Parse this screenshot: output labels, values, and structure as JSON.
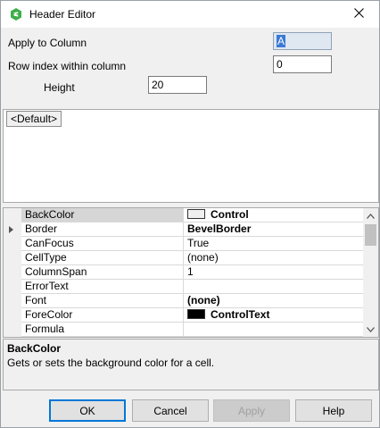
{
  "window": {
    "title": "Header Editor"
  },
  "form": {
    "apply_to_column_label": "Apply to Column",
    "apply_to_column_value": "A",
    "row_index_label": "Row index within column",
    "row_index_value": "0",
    "height_label": "Height",
    "height_value": "20"
  },
  "preview": {
    "tab_label": "<Default>"
  },
  "properties": [
    {
      "name": "BackColor",
      "value": "Control",
      "bold": true,
      "swatch": "#f0f0f0",
      "selected": true,
      "expandable": false
    },
    {
      "name": "Border",
      "value": "BevelBorder",
      "bold": true,
      "swatch": null,
      "selected": false,
      "expandable": true
    },
    {
      "name": "CanFocus",
      "value": "True",
      "bold": false,
      "swatch": null,
      "selected": false,
      "expandable": false
    },
    {
      "name": "CellType",
      "value": "(none)",
      "bold": false,
      "swatch": null,
      "selected": false,
      "expandable": false
    },
    {
      "name": "ColumnSpan",
      "value": "1",
      "bold": false,
      "swatch": null,
      "selected": false,
      "expandable": false
    },
    {
      "name": "ErrorText",
      "value": "",
      "bold": false,
      "swatch": null,
      "selected": false,
      "expandable": false
    },
    {
      "name": "Font",
      "value": "(none)",
      "bold": true,
      "swatch": null,
      "selected": false,
      "expandable": false
    },
    {
      "name": "ForeColor",
      "value": "ControlText",
      "bold": true,
      "swatch": "#000000",
      "selected": false,
      "expandable": false
    },
    {
      "name": "Formula",
      "value": "",
      "bold": false,
      "swatch": null,
      "selected": false,
      "expandable": false
    }
  ],
  "help": {
    "title": "BackColor",
    "description": "Gets or sets the background color for a cell."
  },
  "buttons": {
    "ok": "OK",
    "cancel": "Cancel",
    "apply": "Apply",
    "help": "Help"
  },
  "icons": {
    "app": "spread-designer-icon",
    "close": "close-icon",
    "expand": "expand-arrow-icon",
    "scroll_up": "scroll-up-icon",
    "scroll_down": "scroll-down-icon"
  },
  "colors": {
    "accent": "#0078d7",
    "app_icon": "#3fae49"
  }
}
